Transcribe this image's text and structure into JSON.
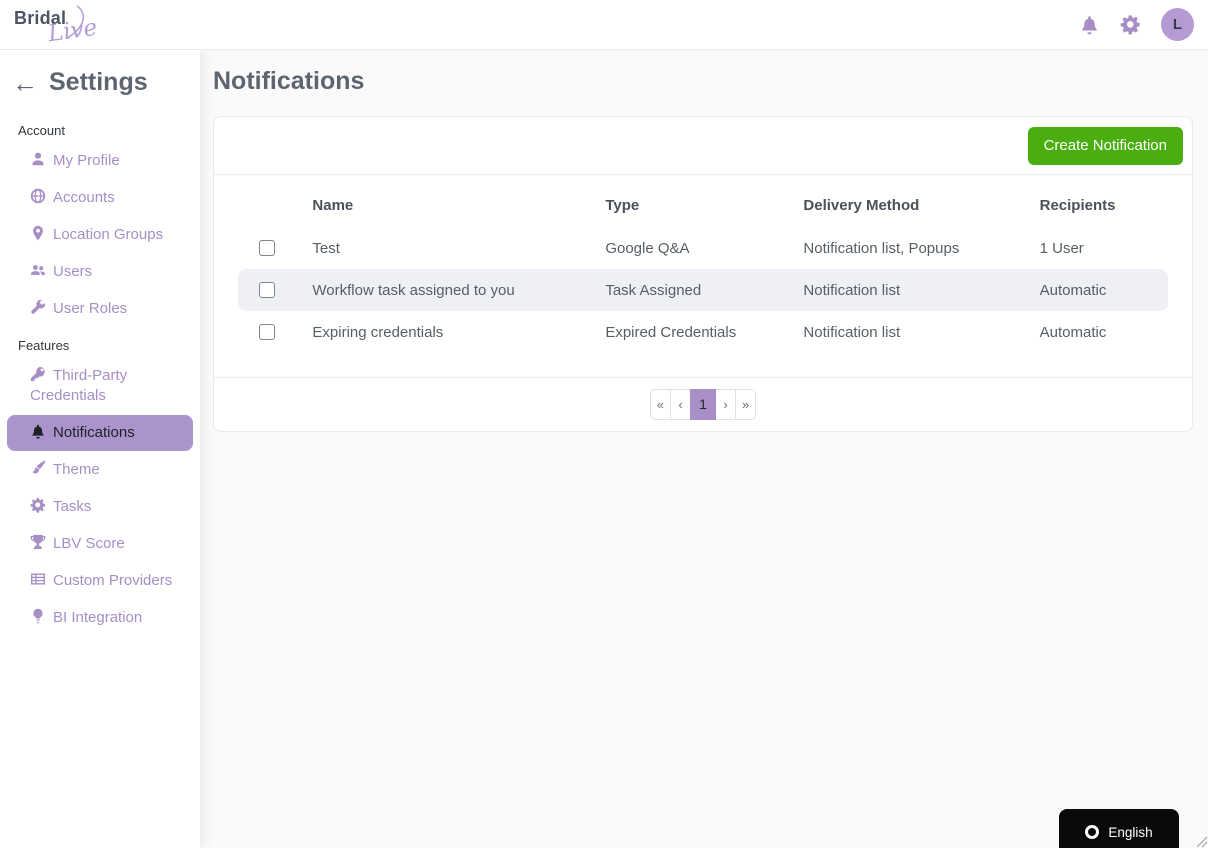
{
  "header": {
    "logo": {
      "part1": "Bridal",
      "part2": "Live"
    },
    "avatar_initial": "L",
    "icons": [
      "bell-icon",
      "gear-icon"
    ]
  },
  "sidebar": {
    "title": "Settings",
    "sections": [
      {
        "label": "Account",
        "items": [
          {
            "label": "My Profile",
            "icon": "user-icon",
            "active": false
          },
          {
            "label": "Accounts",
            "icon": "globe-icon",
            "active": false
          },
          {
            "label": "Location Groups",
            "icon": "map-pin-icon",
            "active": false
          },
          {
            "label": "Users",
            "icon": "users-icon",
            "active": false
          },
          {
            "label": "User Roles",
            "icon": "wrench-icon",
            "active": false
          }
        ]
      },
      {
        "label": "Features",
        "items": [
          {
            "label": "Third-Party Credentials",
            "icon": "key-icon",
            "active": false
          },
          {
            "label": "Notifications",
            "icon": "bell-icon",
            "active": true
          },
          {
            "label": "Theme",
            "icon": "brush-icon",
            "active": false
          },
          {
            "label": "Tasks",
            "icon": "gear-icon",
            "active": false
          },
          {
            "label": "LBV Score",
            "icon": "trophy-icon",
            "active": false
          },
          {
            "label": "Custom Providers",
            "icon": "table-icon",
            "active": false
          },
          {
            "label": "BI Integration",
            "icon": "lightbulb-icon",
            "active": false
          }
        ]
      }
    ]
  },
  "main": {
    "title": "Notifications",
    "create_button_label": "Create Notification",
    "table": {
      "columns": [
        "Name",
        "Type",
        "Delivery Method",
        "Recipients"
      ],
      "rows": [
        {
          "name": "Test",
          "type": "Google Q&A",
          "delivery_method": "Notification list, Popups",
          "recipients": "1 User",
          "checked": false,
          "highlighted": false
        },
        {
          "name": "Workflow task assigned to you",
          "type": "Task Assigned",
          "delivery_method": "Notification list",
          "recipients": "Automatic",
          "checked": false,
          "highlighted": true
        },
        {
          "name": "Expiring credentials",
          "type": "Expired Credentials",
          "delivery_method": "Notification list",
          "recipients": "Automatic",
          "checked": false,
          "highlighted": false
        }
      ]
    },
    "pagination": {
      "buttons": [
        "«",
        "‹",
        "1",
        "›",
        "»"
      ],
      "active_page": "1"
    }
  },
  "language_button": {
    "label": "English"
  },
  "colors": {
    "accent_purple": "#a78fc6",
    "active_item_bg": "#ab93cb",
    "pagination_active_bg": "#a98fc7",
    "create_button_green": "#4aae10",
    "row_highlight": "#eef0f5",
    "heading_text": "#5c6570",
    "language_button_bg": "#0a0a0a"
  }
}
